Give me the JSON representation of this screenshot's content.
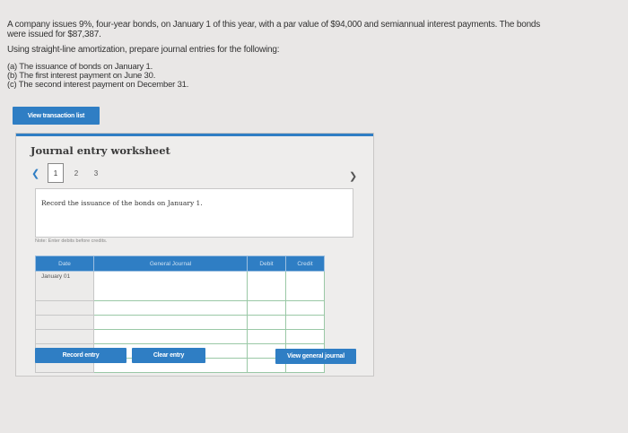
{
  "question": {
    "text": "A company issues 9%, four-year bonds, on January 1 of this year, with a par value of $94,000 and semiannual interest payments. The bonds were issued for $87,387.",
    "instruction": "Using straight-line amortization, prepare journal entries for the following:",
    "items": [
      "(a) The issuance of bonds on January 1.",
      "(b) The first interest payment on June 30.",
      "(c) The second interest payment on December 31."
    ]
  },
  "buttons": {
    "view_transaction_list": "View transaction list",
    "record_entry": "Record entry",
    "clear_entry": "Clear entry",
    "view_general_journal": "View general journal"
  },
  "worksheet": {
    "title": "Journal entry worksheet",
    "pages": [
      "1",
      "2",
      "3"
    ],
    "current_page": "1",
    "instruction": "Record the issuance of the bonds on January 1.",
    "note": "Note: Enter debits before credits.",
    "columns": {
      "date": "Date",
      "account": "General Journal",
      "debit": "Debit",
      "credit": "Credit"
    },
    "rows": [
      {
        "date": "January 01",
        "account": "",
        "debit": "",
        "credit": ""
      },
      {
        "date": "",
        "account": "",
        "debit": "",
        "credit": ""
      },
      {
        "date": "",
        "account": "",
        "debit": "",
        "credit": ""
      },
      {
        "date": "",
        "account": "",
        "debit": "",
        "credit": ""
      },
      {
        "date": "",
        "account": "",
        "debit": "",
        "credit": ""
      },
      {
        "date": "",
        "account": "",
        "debit": "",
        "credit": ""
      }
    ]
  },
  "colors": {
    "accent": "#2f7ec4",
    "background": "#e9e7e6"
  }
}
